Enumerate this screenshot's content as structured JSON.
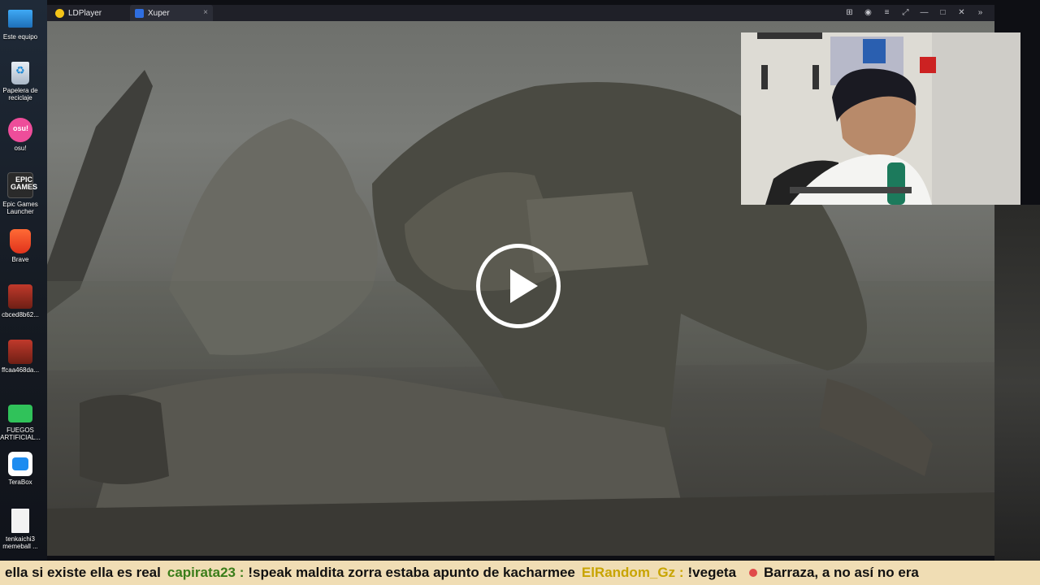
{
  "desktop": {
    "icons": [
      {
        "label": "Este equipo",
        "icon": "computer-icon"
      },
      {
        "label": "Papelera de reciclaje",
        "icon": "recycle-bin-icon"
      },
      {
        "label": "osu!",
        "icon": "osu-icon"
      },
      {
        "label": "Epic Games Launcher",
        "icon": "epic-games-icon"
      },
      {
        "label": "Brave",
        "icon": "brave-icon"
      },
      {
        "label": "cbced8b62...",
        "icon": "game-shortcut-icon"
      },
      {
        "label": "ffcaa468da...",
        "icon": "game-shortcut-icon"
      },
      {
        "label": "FUEGOS ARTIFICIAL...",
        "icon": "fireworks-icon"
      },
      {
        "label": "TeraBox",
        "icon": "terabox-icon"
      },
      {
        "label": "tenkaichi3 memeball ...",
        "icon": "file-icon"
      }
    ]
  },
  "window": {
    "tabs": [
      {
        "label": "LDPlayer",
        "icon": "ldplayer-icon"
      },
      {
        "label": "Xuper",
        "icon": "xuper-icon"
      }
    ],
    "tab_close": "×",
    "controls": [
      "⊞",
      "◉",
      "≡",
      "⤢",
      "—",
      "□",
      "✕",
      "»"
    ]
  },
  "video": {
    "state": "paused",
    "play_icon": "play-icon"
  },
  "chat": {
    "messages": [
      {
        "user": "",
        "text": "ella si existe ella es real"
      },
      {
        "user": "capirata23 :",
        "text": "!speak maldita zorra estaba apunto de kacharmee"
      },
      {
        "user": "ElRandom_Gz :",
        "text": "!vegeta"
      },
      {
        "user": "",
        "text": "Barraza, a no así no era"
      }
    ],
    "colors": {
      "bg": "#f0ddb4",
      "user1": "#3a7d1a",
      "user2": "#c8a400"
    }
  }
}
